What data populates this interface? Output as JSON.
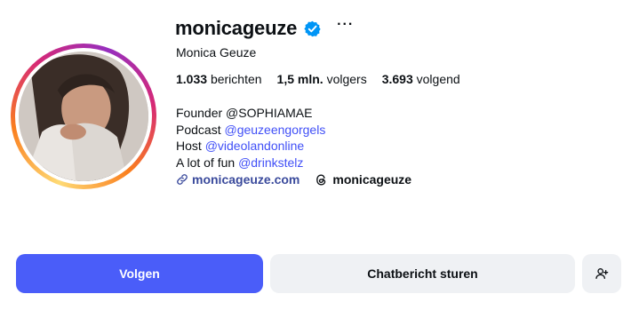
{
  "profile": {
    "username": "monicageuze",
    "full_name": "Monica Geuze",
    "verified": true,
    "more_icon": "ellipsis-icon"
  },
  "stats": [
    {
      "value": "1.033",
      "label": "berichten"
    },
    {
      "value": "1,5 mln.",
      "label": "volgers"
    },
    {
      "value": "3.693",
      "label": "volgend"
    }
  ],
  "bio": [
    {
      "text": "Founder @SOPHIAMAE",
      "mention": ""
    },
    {
      "text": "Podcast ",
      "mention": "@geuzeengorgels"
    },
    {
      "text": "Host ",
      "mention": "@videolandonline"
    },
    {
      "text": "A lot of fun ",
      "mention": "@drinkstelz"
    }
  ],
  "links": {
    "website": "monicageuze.com",
    "threads": "monicageuze"
  },
  "buttons": {
    "follow": "Volgen",
    "message": "Chatbericht sturen",
    "suggest_icon": "add-person-icon"
  },
  "colors": {
    "follow_bg": "#4a5df9",
    "mention": "#4150f7",
    "verified": "#0095f6",
    "secondary_btn": "#eff1f4"
  }
}
